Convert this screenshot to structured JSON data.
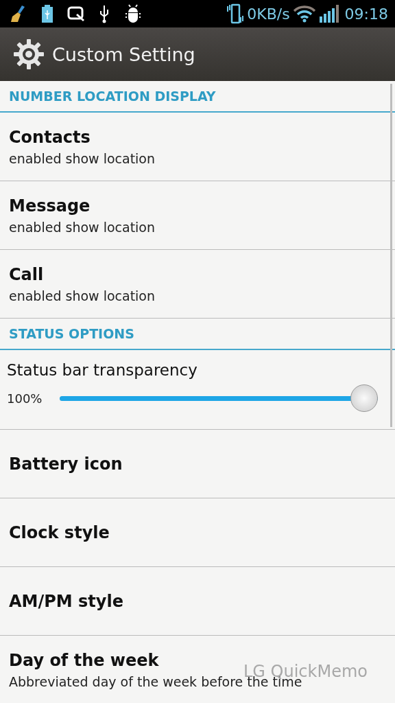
{
  "status_bar": {
    "speed": "0KB/s",
    "time": "09:18"
  },
  "action_bar": {
    "title": "Custom Setting"
  },
  "sections": [
    {
      "header": "NUMBER LOCATION DISPLAY",
      "rows": [
        {
          "kind": "item",
          "title": "Contacts",
          "summary": "enabled show location"
        },
        {
          "kind": "item",
          "title": "Message",
          "summary": "enabled show location"
        },
        {
          "kind": "item",
          "title": "Call",
          "summary": "enabled show location"
        }
      ]
    },
    {
      "header": "STATUS OPTIONS",
      "rows": [
        {
          "kind": "slider",
          "title": "Status bar transparency",
          "reading": "100%",
          "level": 1
        },
        {
          "kind": "item",
          "title": "Battery icon"
        },
        {
          "kind": "item",
          "title": "Clock style"
        },
        {
          "kind": "item",
          "title": "AM/PM style"
        },
        {
          "kind": "item",
          "title": "Day of the week",
          "summary": "Abbreviated day of the week before the time"
        }
      ]
    }
  ],
  "overlay": {
    "caption": "LG QuickMemo"
  }
}
